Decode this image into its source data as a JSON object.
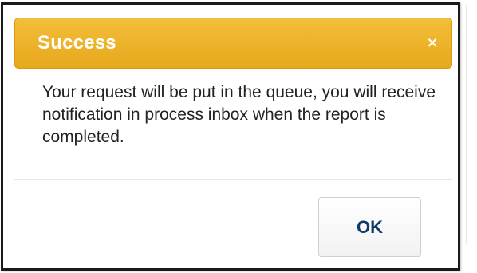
{
  "dialog": {
    "title": "Success",
    "close_label": "×",
    "message": "Your request will be put in the queue, you will receive notification in process inbox when the report is completed.",
    "ok_label": "OK"
  },
  "colors": {
    "header_background": "#e7a81c",
    "header_text": "#ffffff",
    "ok_text": "#123a67"
  }
}
